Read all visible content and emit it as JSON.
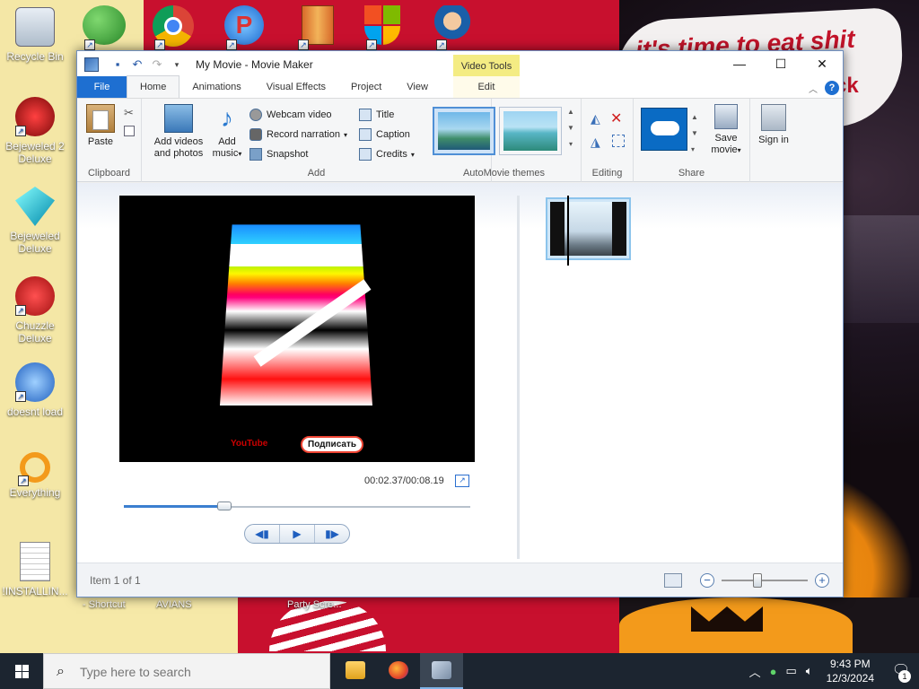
{
  "desktop": {
    "icons": [
      {
        "label": "Recycle Bin",
        "icon": "recycle-bin-icon"
      },
      {
        "label": "Bejeweled 2 Deluxe",
        "icon": "bejeweled-2-icon"
      },
      {
        "label": "Bejeweled Deluxe",
        "icon": "bejeweled-icon"
      },
      {
        "label": "Chuzzle Deluxe",
        "icon": "chuzzle-icon"
      },
      {
        "label": "doesnt load",
        "icon": "thunderbird-icon"
      },
      {
        "label": "Everything",
        "icon": "everything-search-icon"
      },
      {
        "label": "!INSTALLIN...",
        "icon": "text-document-icon"
      }
    ],
    "top_icons": [
      "messenger-icon",
      "chrome-icon",
      "paint-dot-net-icon",
      "winrar-icon",
      "windows-defender-icon",
      "game-character-icon"
    ],
    "bottom_labels": [
      "- Shortcut",
      "AVIANS",
      "Party Scre..."
    ],
    "wallpaper_text_1": "it's time to eat shit",
    "wallpaper_text_2": "ck"
  },
  "window": {
    "title": "My Movie - Movie Maker",
    "contextual_tab_group": "Video Tools",
    "controls": {
      "minimize": "—",
      "maximize": "☐",
      "close": "✕"
    },
    "menu_tabs": [
      "File",
      "Home",
      "Animations",
      "Visual Effects",
      "Project",
      "View",
      "Edit"
    ],
    "active_tab": "Home"
  },
  "ribbon": {
    "clipboard": {
      "paste": "Paste",
      "group_label": "Clipboard"
    },
    "add": {
      "add_videos": "Add videos and photos",
      "add_music": "Add music",
      "webcam": "Webcam video",
      "narration": "Record narration",
      "snapshot": "Snapshot",
      "title": "Title",
      "caption": "Caption",
      "credits": "Credits",
      "group_label": "Add"
    },
    "themes": {
      "group_label": "AutoMovie themes"
    },
    "editing": {
      "group_label": "Editing"
    },
    "share": {
      "save_movie": "Save movie",
      "sign_in": "Sign in",
      "group_label": "Share"
    }
  },
  "preview": {
    "badge_text": "Подписать",
    "badge_left_text": "YouTube",
    "time": "00:02.37/00:08.19",
    "progress": 0.29
  },
  "status": {
    "item_text": "Item 1 of 1",
    "zoom_level": 0.42
  },
  "taskbar": {
    "search_placeholder": "Type here to search",
    "apps": [
      "file-explorer-icon",
      "firefox-icon",
      "movie-maker-icon"
    ],
    "time": "9:43 PM",
    "date": "12/3/2024",
    "notifications": "1"
  },
  "colors": {
    "accent": "#1e6fd1",
    "video_tools": "#f4ec83",
    "taskbar": "#1c2530"
  }
}
